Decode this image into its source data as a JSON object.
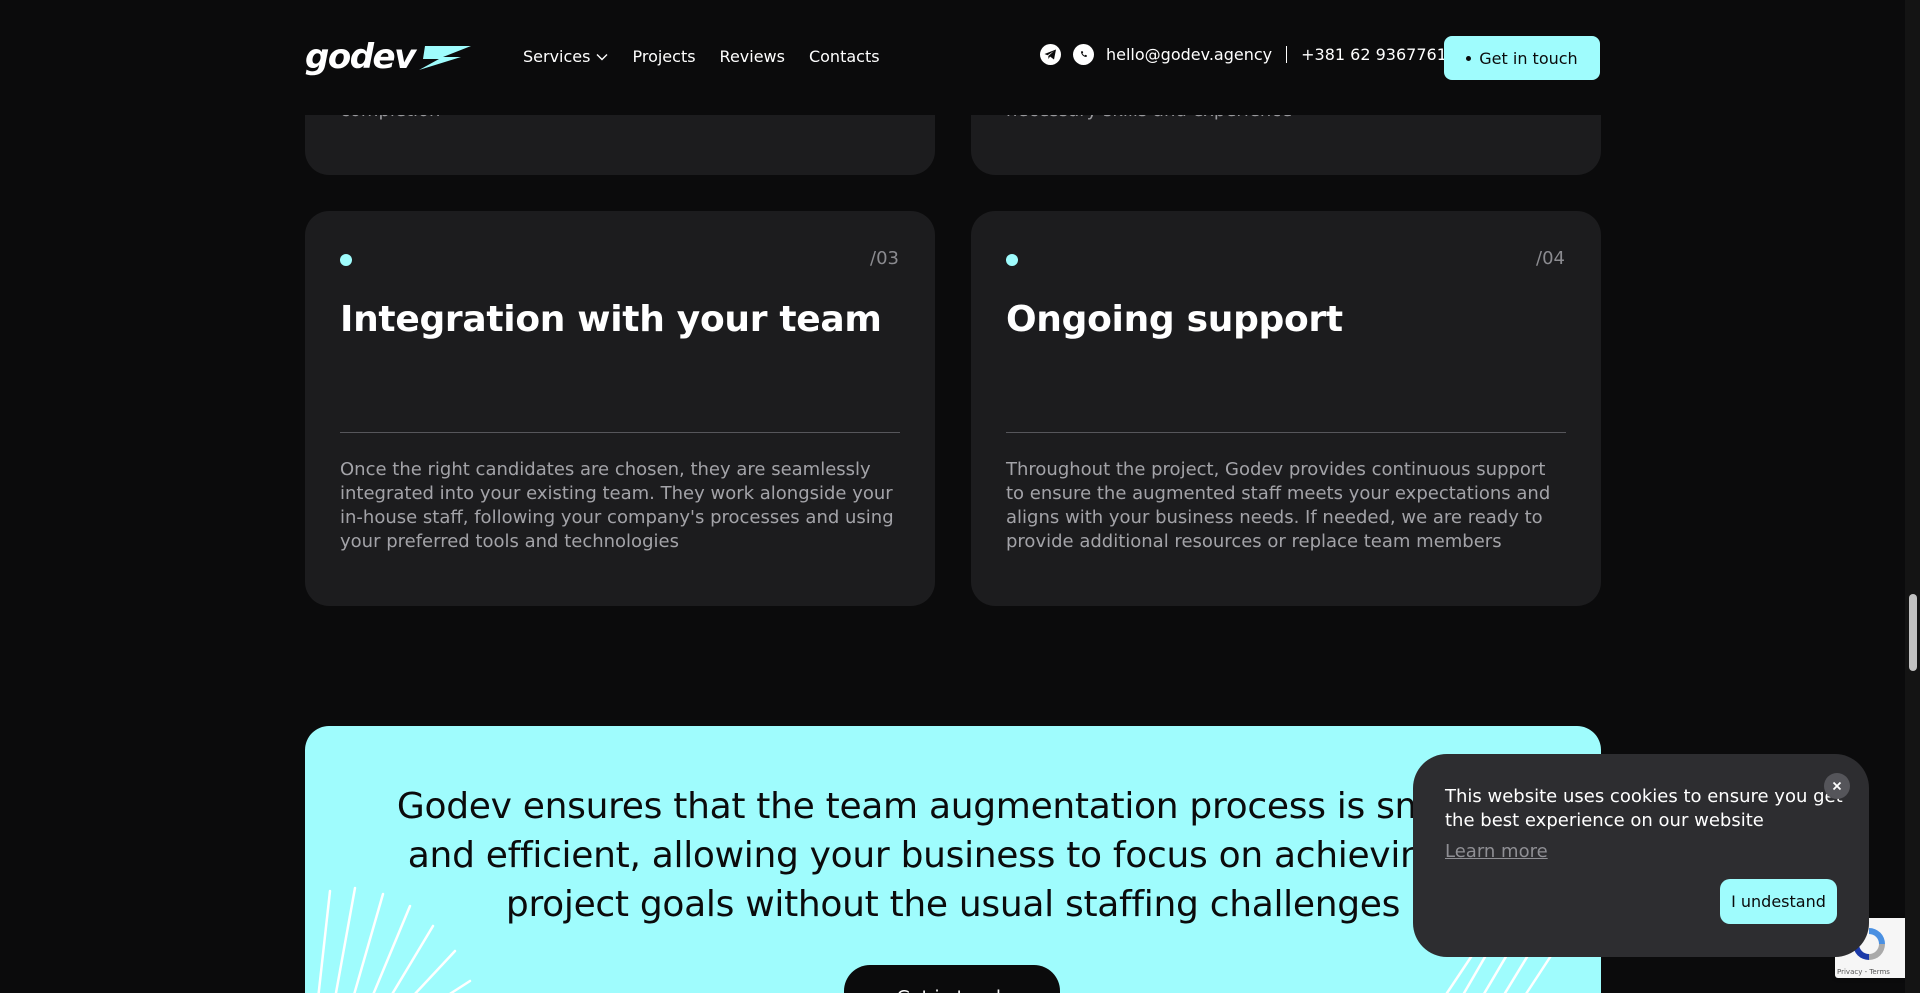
{
  "header": {
    "logo_text": "godev",
    "nav": [
      {
        "label": "Services"
      },
      {
        "label": "Projects"
      },
      {
        "label": "Reviews"
      },
      {
        "label": "Contacts"
      }
    ],
    "email": "hello@godev.agency",
    "phone": "+381 62 9367761",
    "cta_label": "Get in touch"
  },
  "top_cards": {
    "left_fragment": "completion",
    "right_fragment": "necessary skills and experience"
  },
  "cards": [
    {
      "num": "/03",
      "title": "Integration with your team",
      "desc": "Once the right candidates are chosen, they are seamlessly integrated into your existing team. They work alongside your in-house staff, following your company's processes and using your preferred tools and technologies"
    },
    {
      "num": "/04",
      "title": "Ongoing support",
      "desc": "Throughout the project, Godev provides continuous support to ensure the augmented staff meets your expectations and aligns with your business needs. If needed, we are ready to provide additional resources or replace team members"
    }
  ],
  "cta_block": {
    "text": "Godev ensures that the team augmentation process is smooth and efficient, allowing your business to focus on achieving its project goals without the usual staffing challenges",
    "button_label": "Get in touch"
  },
  "cookie": {
    "text": "This website uses cookies to ensure you get the best experience on our website",
    "link": "Learn more",
    "accept": "I undestand"
  },
  "recaptcha": {
    "terms": "Privacy - Terms"
  },
  "colors": {
    "accent": "#9ffcfd",
    "background": "#0b0b0c",
    "card": "#1c1c1e",
    "cookie_bg": "#2d2d30"
  }
}
